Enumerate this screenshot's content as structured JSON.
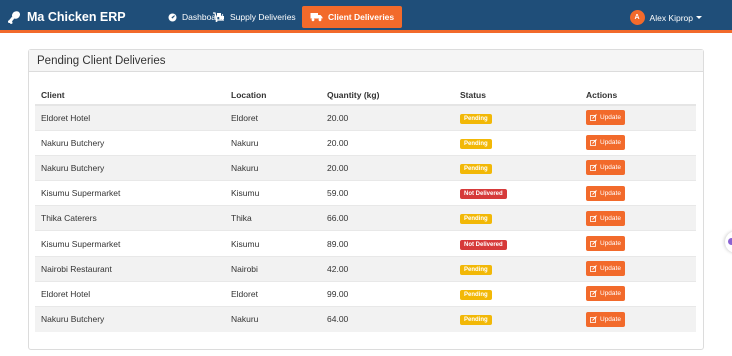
{
  "navbar": {
    "brand": "Ma Chicken ERP",
    "items": [
      {
        "label": "Dashboard",
        "icon": "dashboard-gauge-icon",
        "active": false
      },
      {
        "label": "Supply Deliveries",
        "icon": "dolly-icon",
        "active": false
      },
      {
        "label": "Client Deliveries",
        "icon": "truck-icon",
        "active": true
      }
    ],
    "user": {
      "initial": "A",
      "name": "Alex Kiprop"
    }
  },
  "panel": {
    "title": "Pending Client Deliveries",
    "columns": [
      "Client",
      "Location",
      "Quantity (kg)",
      "Status",
      "Actions"
    ],
    "action_label": "Update",
    "rows": [
      {
        "client": "Eldoret Hotel",
        "location": "Eldoret",
        "quantity": "20.00",
        "status": "Pending"
      },
      {
        "client": "Nakuru Butchery",
        "location": "Nakuru",
        "quantity": "20.00",
        "status": "Pending"
      },
      {
        "client": "Nakuru Butchery",
        "location": "Nakuru",
        "quantity": "20.00",
        "status": "Pending"
      },
      {
        "client": "Kisumu Supermarket",
        "location": "Kisumu",
        "quantity": "59.00",
        "status": "Not Delivered"
      },
      {
        "client": "Thika Caterers",
        "location": "Thika",
        "quantity": "66.00",
        "status": "Pending"
      },
      {
        "client": "Kisumu Supermarket",
        "location": "Kisumu",
        "quantity": "89.00",
        "status": "Not Delivered"
      },
      {
        "client": "Nairobi Restaurant",
        "location": "Nairobi",
        "quantity": "42.00",
        "status": "Pending"
      },
      {
        "client": "Eldoret Hotel",
        "location": "Eldoret",
        "quantity": "99.00",
        "status": "Pending"
      },
      {
        "client": "Nakuru Butchery",
        "location": "Nakuru",
        "quantity": "64.00",
        "status": "Pending"
      }
    ]
  },
  "colors": {
    "navbar_bg": "#1f4e79",
    "accent": "#f26a2b",
    "pending": "#f2b807",
    "not_delivered": "#d63a3a"
  }
}
